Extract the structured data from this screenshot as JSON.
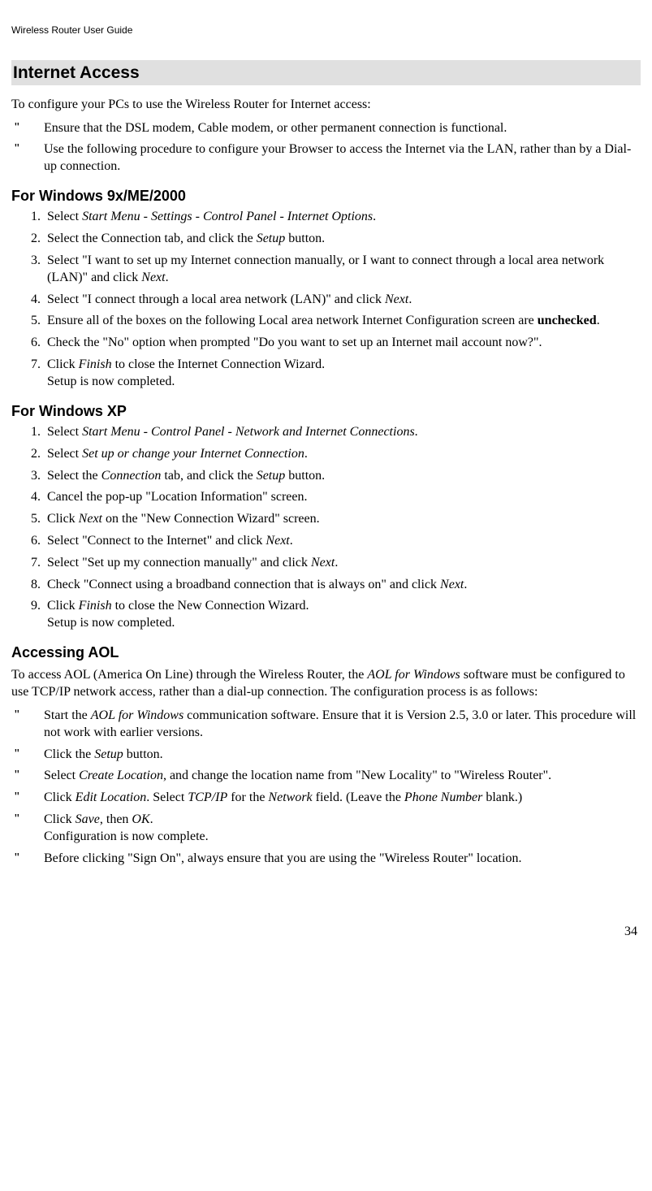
{
  "runningHeader": "Wireless Router User Guide",
  "pageNumber": "34",
  "section": {
    "title": "Internet Access",
    "intro": "To configure your PCs to use the Wireless Router for Internet access:",
    "introBullets": [
      "Ensure that the DSL modem, Cable modem, or other permanent connection is functional.",
      "Use the following procedure to configure your Browser to access the Internet via the LAN, rather than by a Dial-up connection."
    ],
    "win9x": {
      "title": "For Windows 9x/ME/2000",
      "steps": [
        {
          "pre": "Select ",
          "em": "Start Menu - Settings - Control Panel - Internet Options",
          "post": "."
        },
        {
          "pre": "Select the Connection tab, and click the ",
          "em": "Setup",
          "post": " button."
        },
        {
          "pre": "Select \"I want to set up my Internet connection manually, or I want to connect through a local area network (LAN)\" and click ",
          "em": "Next",
          "post": "."
        },
        {
          "pre": "Select \"I connect through a local area network (LAN)\" and click ",
          "em": "Next",
          "post": "."
        },
        {
          "pre": "Ensure all of the boxes on the following Local area network Internet Configuration screen are ",
          "bold": "unchecked",
          "post": "."
        },
        {
          "text": "Check the \"No\" option when prompted \"Do you want to set up an Internet mail account now?\"."
        },
        {
          "pre": "Click ",
          "em": "Finish",
          "post": " to close the Internet Connection Wizard.",
          "line2": "Setup is now completed."
        }
      ]
    },
    "winxp": {
      "title": "For Windows XP",
      "steps": [
        {
          "pre": "Select ",
          "em": "Start Menu - Control Panel - Network and Internet Connections",
          "post": "."
        },
        {
          "pre": "Select ",
          "em": "Set up or change your Internet Connection",
          "post": "."
        },
        {
          "pre": "Select the ",
          "em": "Connection",
          "mid": " tab, and click the ",
          "em2": "Setup",
          "post": " button."
        },
        {
          "text": "Cancel the pop-up \"Location Information\" screen."
        },
        {
          "pre": "Click ",
          "em": "Next",
          "post": " on the \"New Connection Wizard\" screen."
        },
        {
          "pre": "Select \"Connect to the Internet\" and click ",
          "em": "Next",
          "post": "."
        },
        {
          "pre": "Select \"Set up my connection manually\" and click ",
          "em": "Next",
          "post": "."
        },
        {
          "pre": "Check \"Connect using a broadband connection that is always on\" and click ",
          "em": "Next",
          "post": "."
        },
        {
          "pre": "Click ",
          "em": "Finish",
          "post": " to close the New Connection Wizard.",
          "line2": "Setup is now completed."
        }
      ]
    },
    "aol": {
      "title": "Accessing AOL",
      "intro_pre": "To access AOL (America On Line) through the Wireless Router, the ",
      "intro_em": "AOL for Windows",
      "intro_post": " software must be configured to use TCP/IP network access, rather than a dial-up connection. The configuration process is as follows:",
      "bullets": [
        {
          "pre": "Start the ",
          "em": "AOL for Windows",
          "post": " communication software. Ensure that it is Version 2.5, 3.0 or later. This procedure will not work with earlier versions."
        },
        {
          "pre": "Click the ",
          "em": "Setup",
          "post": " button."
        },
        {
          "pre": "Select ",
          "em": "Create Location",
          "post": ", and change the location name from \"New Locality\" to \"Wireless Router\"."
        },
        {
          "pre": "Click ",
          "em": "Edit Location",
          "mid": ". Select ",
          "em2": "TCP/IP",
          "mid2": " for the ",
          "em3": "Network",
          "mid3": " field. (Leave the ",
          "em4": "Phone Number",
          "post": " blank.)"
        },
        {
          "pre": "Click ",
          "em": "Save",
          "mid": ", then ",
          "em2": "OK",
          "post": ".",
          "line2": "Configuration is now complete."
        },
        {
          "text": "Before clicking \"Sign On\", always ensure that you are using the \"Wireless Router\" location."
        }
      ]
    }
  }
}
